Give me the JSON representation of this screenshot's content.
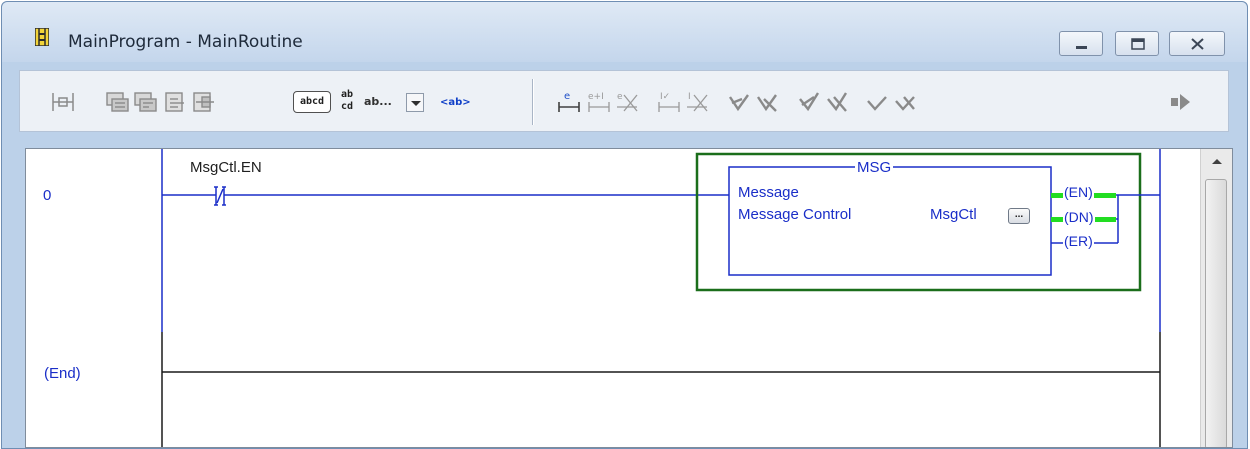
{
  "window": {
    "title": "MainProgram - MainRoutine",
    "icons": {
      "app": "ladder-program-icon",
      "minimize": "minimize-icon",
      "maximize": "maximize-icon",
      "close": "close-icon"
    }
  },
  "toolbar": {
    "abcd_label": "abcd",
    "stack_top": "ab",
    "stack_bottom": "cd",
    "combo_value": "ab...",
    "ab_tag_label": "<ab>",
    "icons": [
      "rung-icon",
      "add-branch-icon",
      "add-branch-level-icon",
      "insert-rung-icon",
      "append-rung-icon",
      "start-edits-icon",
      "accept-rung-icon",
      "cancel-edits-icon",
      "accept-pending-icon",
      "cancel-pending-icon",
      "test-edits-icon",
      "untest-edits-icon",
      "assemble-edits-icon",
      "cancel-accepted-icon",
      "finalize-edits-icon",
      "discard-edits-icon",
      "go-online-icon"
    ]
  },
  "editor": {
    "rungs": [
      {
        "number": "0"
      },
      {
        "number": "(End)"
      }
    ],
    "contact": {
      "tag": "MsgCtl.EN",
      "type": "XIO"
    },
    "instruction": {
      "name": "MSG",
      "row1": "Message",
      "row2_label": "Message Control",
      "row2_value": "MsgCtl",
      "browse_label": "...",
      "outputs": [
        "EN",
        "DN",
        "ER"
      ]
    },
    "colors": {
      "rail": "#1a2ec8",
      "instruction_box": "#1a2ec8",
      "highlight_border": "#1b6e1b",
      "power_flow": "#22dd22"
    }
  }
}
